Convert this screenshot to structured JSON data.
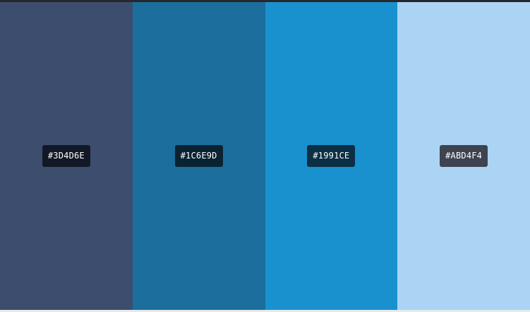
{
  "palette": {
    "colors": [
      {
        "hex": "#3D4D6E",
        "swatch_color": "#3d4d6e",
        "label_bg": "#121826"
      },
      {
        "hex": "#1C6E9D",
        "swatch_color": "#1c6e9d",
        "label_bg": "#0a2333"
      },
      {
        "hex": "#1991CE",
        "swatch_color": "#1991ce",
        "label_bg": "#0b2f44"
      },
      {
        "hex": "#ABD4F4",
        "swatch_color": "#abd4f4",
        "label_bg": "#3d4450"
      }
    ]
  }
}
